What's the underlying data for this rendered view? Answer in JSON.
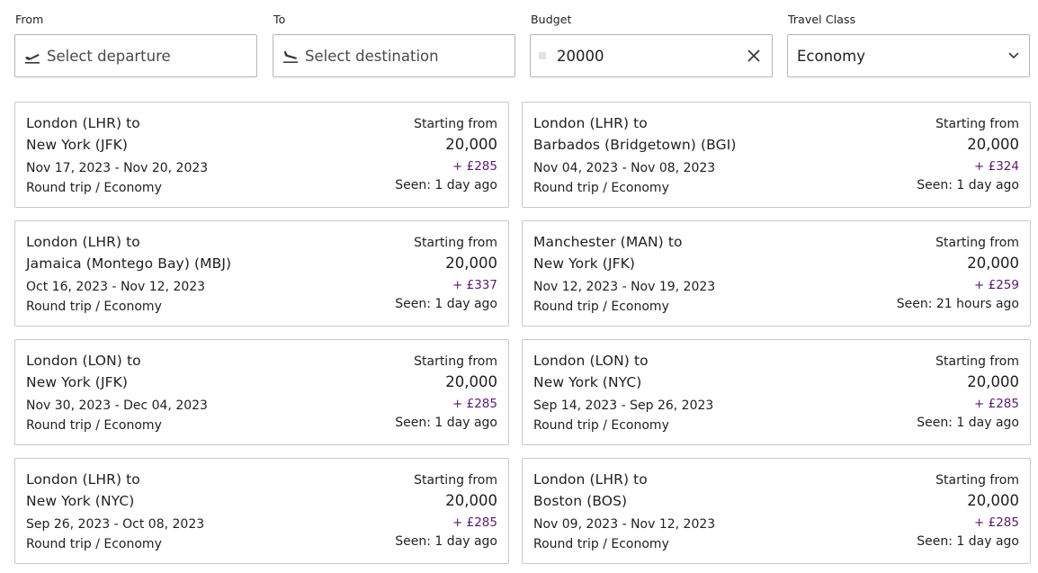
{
  "filters": {
    "from": {
      "label": "From",
      "placeholder": "Select departure",
      "icon": "plane-takeoff-icon"
    },
    "to": {
      "label": "To",
      "placeholder": "Select destination",
      "icon": "plane-landing-icon"
    },
    "budget": {
      "label": "Budget",
      "value": "20000",
      "clear_icon": "close-icon"
    },
    "travel_class": {
      "label": "Travel Class",
      "value": "Economy",
      "icon": "chevron-down-icon"
    }
  },
  "cards": [
    {
      "route_line1": "London (LHR) to",
      "route_line2": "New York (JFK)",
      "dates": "Nov 17, 2023 - Nov 20, 2023",
      "trip": "Round trip / Economy",
      "starting_from": "Starting from",
      "points": "20,000",
      "cash": "+ £285",
      "seen": "Seen: 1 day ago"
    },
    {
      "route_line1": "London (LHR) to",
      "route_line2": "Barbados (Bridgetown) (BGI)",
      "dates": "Nov 04, 2023 - Nov 08, 2023",
      "trip": "Round trip / Economy",
      "starting_from": "Starting from",
      "points": "20,000",
      "cash": "+ £324",
      "seen": "Seen: 1 day ago"
    },
    {
      "route_line1": "London (LHR) to",
      "route_line2": "Jamaica (Montego Bay) (MBJ)",
      "dates": "Oct 16, 2023 - Nov 12, 2023",
      "trip": "Round trip / Economy",
      "starting_from": "Starting from",
      "points": "20,000",
      "cash": "+ £337",
      "seen": "Seen: 1 day ago"
    },
    {
      "route_line1": "Manchester (MAN) to",
      "route_line2": "New York (JFK)",
      "dates": "Nov 12, 2023 - Nov 19, 2023",
      "trip": "Round trip / Economy",
      "starting_from": "Starting from",
      "points": "20,000",
      "cash": "+ £259",
      "seen": "Seen: 21 hours ago"
    },
    {
      "route_line1": "London (LON) to",
      "route_line2": "New York (JFK)",
      "dates": "Nov 30, 2023 - Dec 04, 2023",
      "trip": "Round trip / Economy",
      "starting_from": "Starting from",
      "points": "20,000",
      "cash": "+ £285",
      "seen": "Seen: 1 day ago"
    },
    {
      "route_line1": "London (LON) to",
      "route_line2": "New York (NYC)",
      "dates": "Sep 14, 2023 - Sep 26, 2023",
      "trip": "Round trip / Economy",
      "starting_from": "Starting from",
      "points": "20,000",
      "cash": "+ £285",
      "seen": "Seen: 1 day ago"
    },
    {
      "route_line1": "London (LHR) to",
      "route_line2": "New York (NYC)",
      "dates": "Sep 26, 2023 - Oct 08, 2023",
      "trip": "Round trip / Economy",
      "starting_from": "Starting from",
      "points": "20,000",
      "cash": "+ £285",
      "seen": "Seen: 1 day ago"
    },
    {
      "route_line1": "London (LHR) to",
      "route_line2": "Boston (BOS)",
      "dates": "Nov 09, 2023 - Nov 12, 2023",
      "trip": "Round trip / Economy",
      "starting_from": "Starting from",
      "points": "20,000",
      "cash": "+ £285",
      "seen": "Seen: 1 day ago"
    }
  ],
  "colors": {
    "cash_accent": "#5a1a6e",
    "border": "#c9c9c9",
    "text": "#1f1f1f"
  }
}
